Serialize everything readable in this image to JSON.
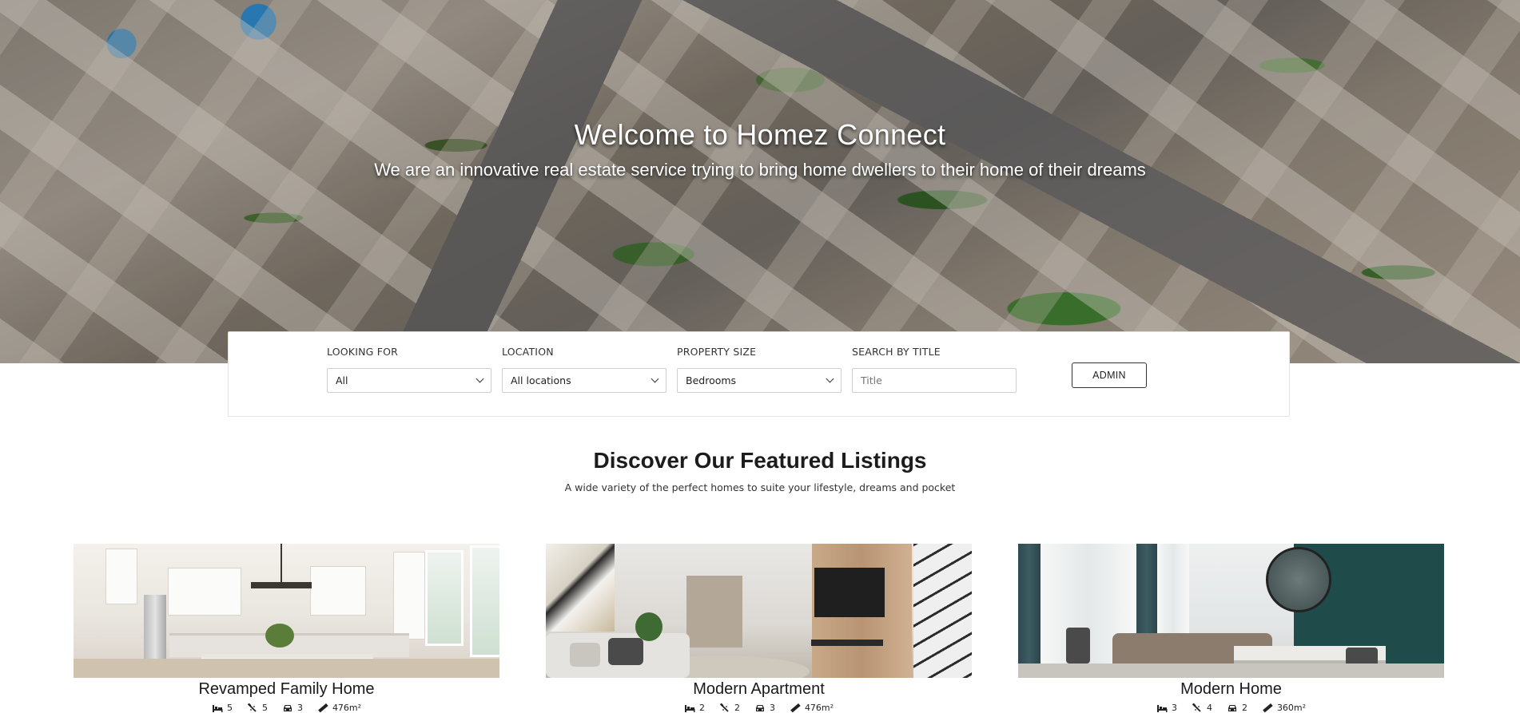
{
  "hero": {
    "title": "Welcome to Homez Connect",
    "subtitle": "We are an innovative real estate service trying to bring home dwellers to their home of their dreams"
  },
  "search": {
    "looking_for": {
      "label": "LOOKING FOR",
      "value": "All"
    },
    "location": {
      "label": "LOCATION",
      "value": "All locations"
    },
    "property_size": {
      "label": "PROPERTY SIZE",
      "value": "Bedrooms"
    },
    "title_search": {
      "label": "SEARCH BY TITLE",
      "placeholder": "Title"
    },
    "admin_label": "ADMIN"
  },
  "featured": {
    "title": "Discover Our Featured Listings",
    "subtitle": "A wide variety of the perfect homes to suite your lifestyle, dreams and pocket",
    "listings": [
      {
        "title": "Revamped Family Home",
        "bedrooms": "5",
        "bathrooms": "5",
        "garages": "3",
        "area": "476m²",
        "image": "kitchen-photo"
      },
      {
        "title": "Modern Apartment",
        "bedrooms": "2",
        "bathrooms": "2",
        "garages": "3",
        "area": "476m²",
        "image": "living-room-photo"
      },
      {
        "title": "Modern Home",
        "bedrooms": "3",
        "bathrooms": "4",
        "garages": "2",
        "area": "360m²",
        "image": "lounge-photo"
      }
    ]
  },
  "icons": {
    "bed": "bed-icon",
    "bath": "bath-icon",
    "car": "car-icon",
    "area": "ruler-icon",
    "dropdown": "chevron-down-icon"
  }
}
